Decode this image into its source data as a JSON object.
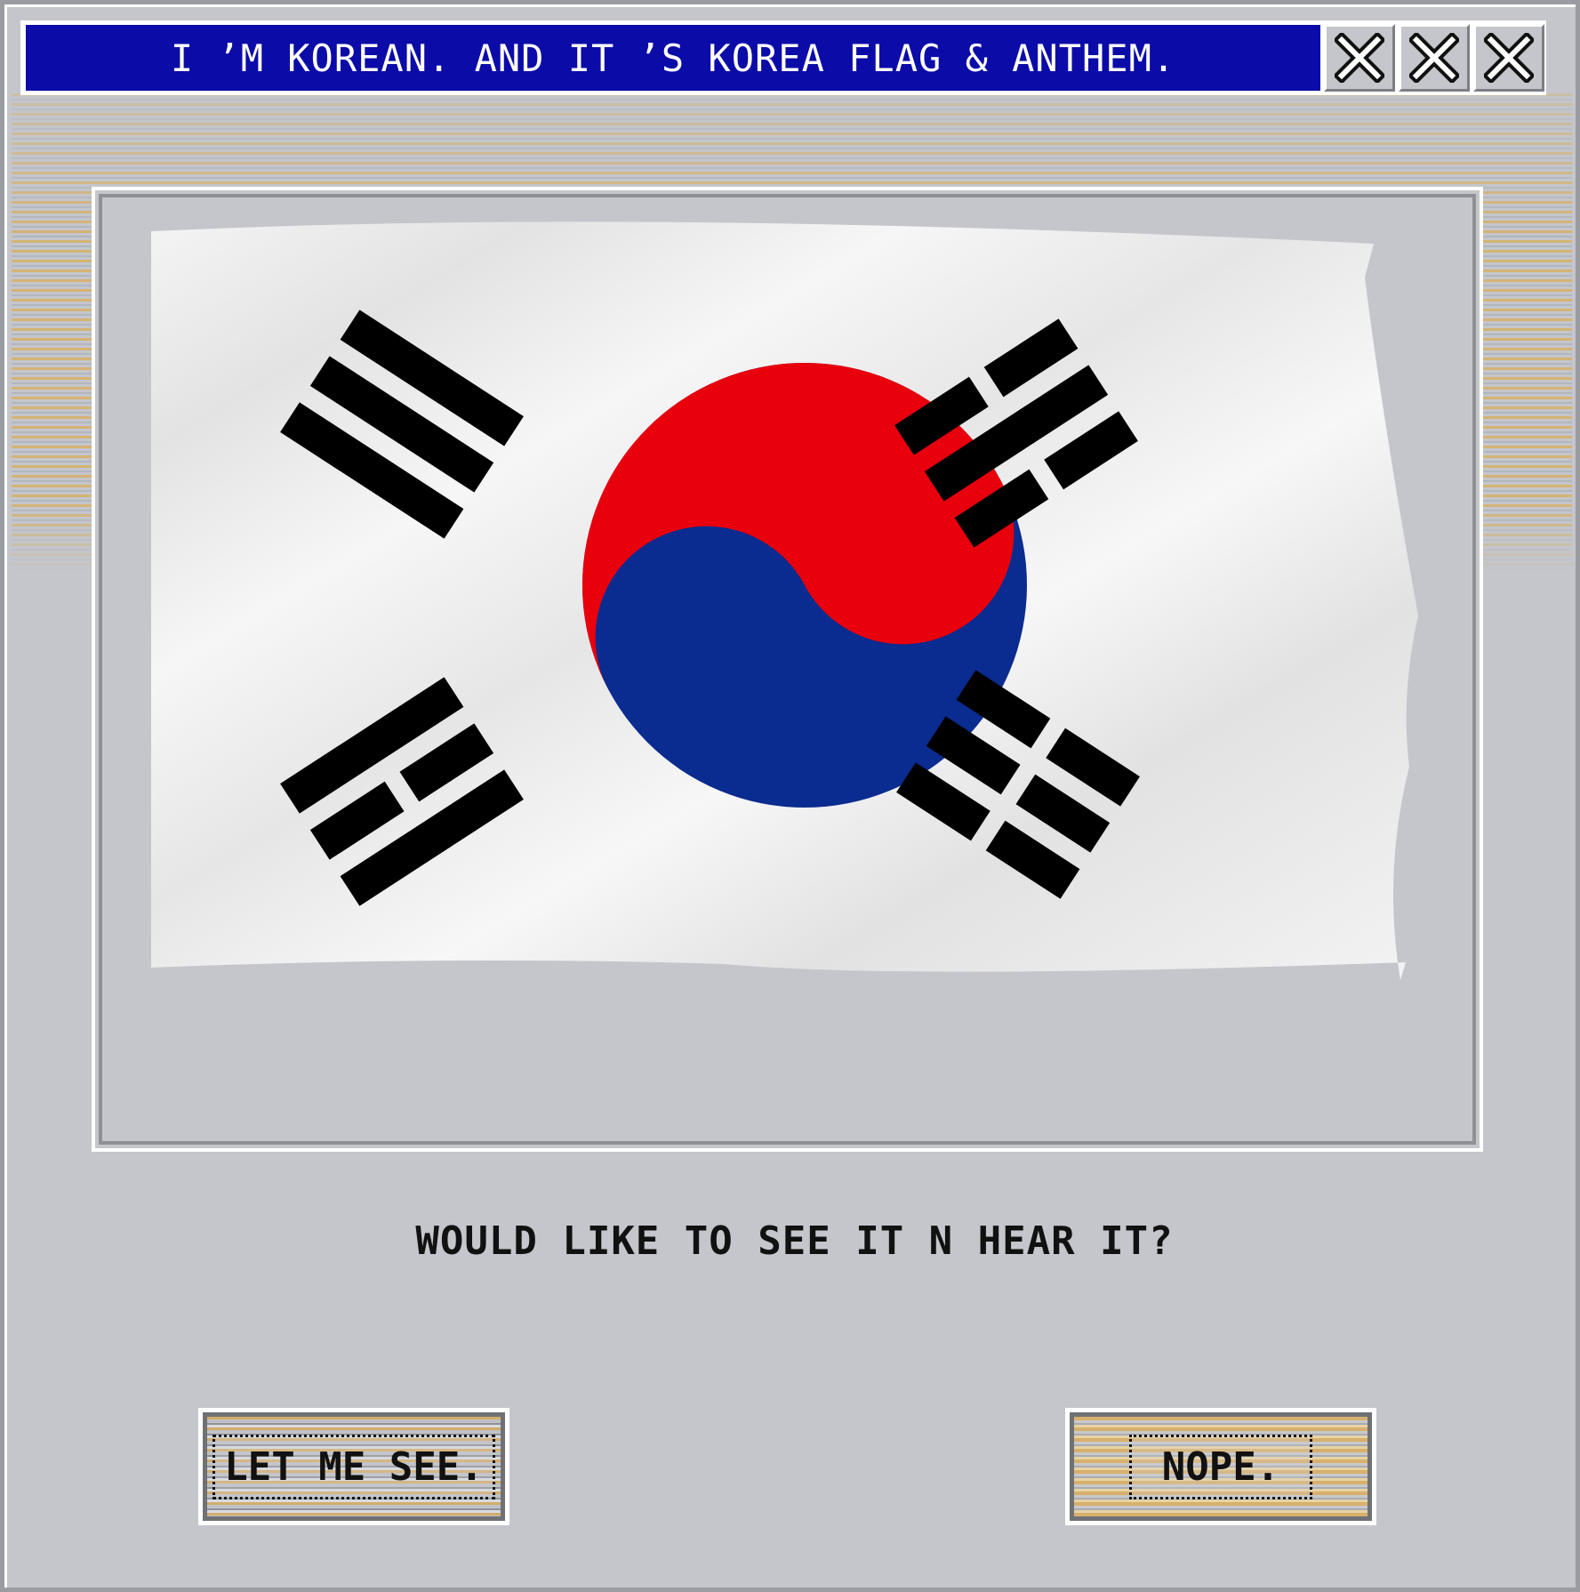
{
  "window": {
    "title": "I ’M KOREAN. AND IT ’S KOREA FLAG & ANTHEM.",
    "close_buttons": [
      "close-icon",
      "close-icon",
      "close-icon"
    ]
  },
  "image": {
    "subject": "flag-of-south-korea",
    "colors": {
      "red": "#e8000c",
      "blue": "#0a2b8f",
      "black": "#000000",
      "white": "#f2f2f2"
    }
  },
  "dialog": {
    "question": "WOULD LIKE TO SEE IT N HEAR IT?",
    "confirm_label": "LET ME SEE.",
    "cancel_label": "NOPE."
  },
  "theme": {
    "title_bar": "#0b0ba8",
    "window_bg": "#c4c6cb",
    "accent_gold": "#d8b06c"
  }
}
